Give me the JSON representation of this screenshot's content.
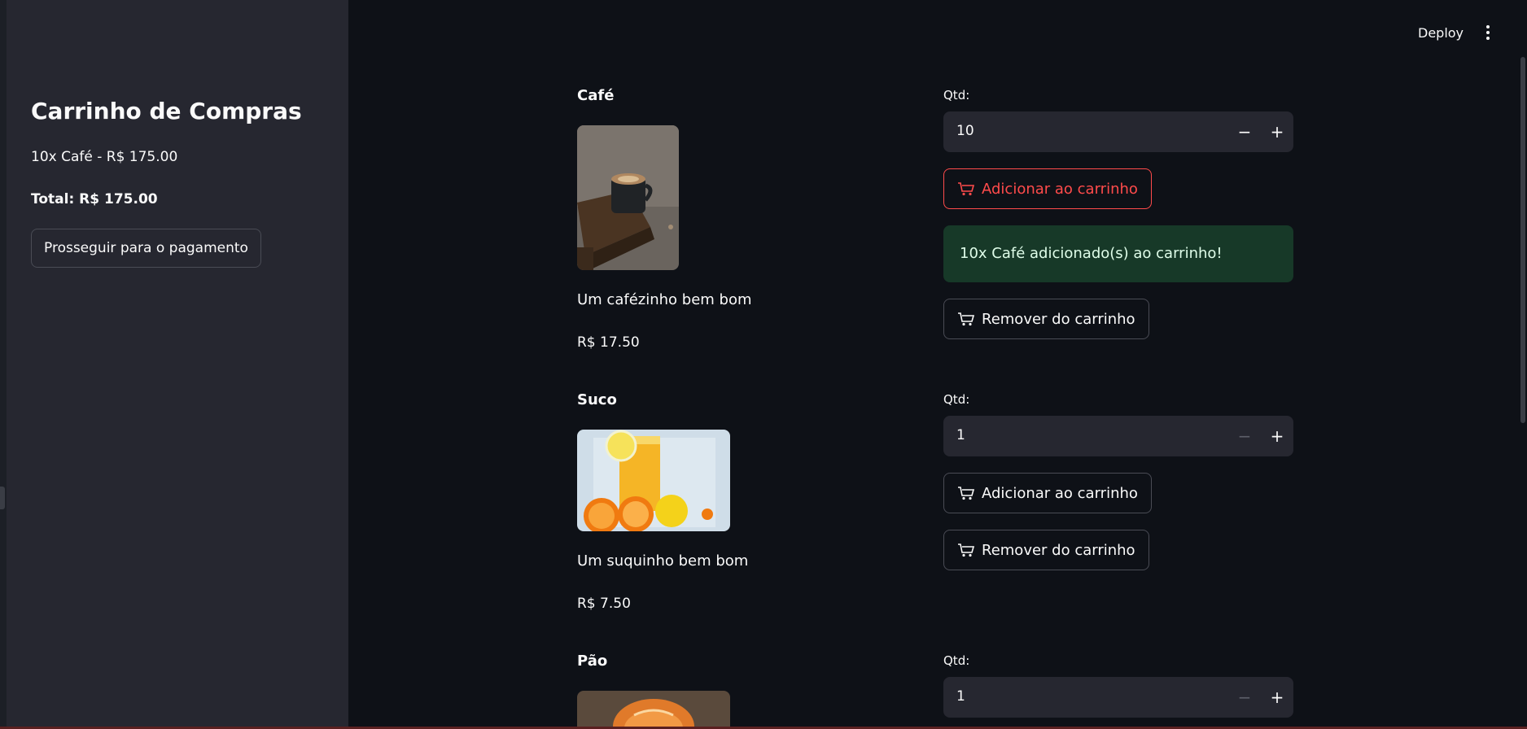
{
  "header": {
    "deploy_label": "Deploy",
    "menu_icon": "kebab-menu-icon"
  },
  "sidebar": {
    "title": "Carrinho de Compras",
    "items": [
      "10x Café - R$ 175.00"
    ],
    "total": "Total: R$ 175.00",
    "checkout_label": "Prosseguir para o pagamento"
  },
  "products": [
    {
      "name": "Café",
      "description": "Um cafézinho bem bom",
      "price": "R$ 17.50",
      "qty_label": "Qtd:",
      "qty_value": "10",
      "minus_symbol": "−",
      "plus_symbol": "+",
      "add_label": "Adicionar ao carrinho",
      "remove_label": "Remover do carrinho",
      "success_message": "10x Café adicionado(s) ao carrinho!"
    },
    {
      "name": "Suco",
      "description": "Um suquinho bem bom",
      "price": "R$ 7.50",
      "qty_label": "Qtd:",
      "qty_value": "1",
      "minus_symbol": "−",
      "plus_symbol": "+",
      "add_label": "Adicionar ao carrinho",
      "remove_label": "Remover do carrinho"
    },
    {
      "name": "Pão",
      "qty_label": "Qtd:",
      "qty_value": "1",
      "minus_symbol": "−",
      "plus_symbol": "+"
    }
  ],
  "colors": {
    "background": "#0e1117",
    "sidebar": "#262730",
    "accent": "#ff4b4b",
    "success_bg": "#173928"
  }
}
